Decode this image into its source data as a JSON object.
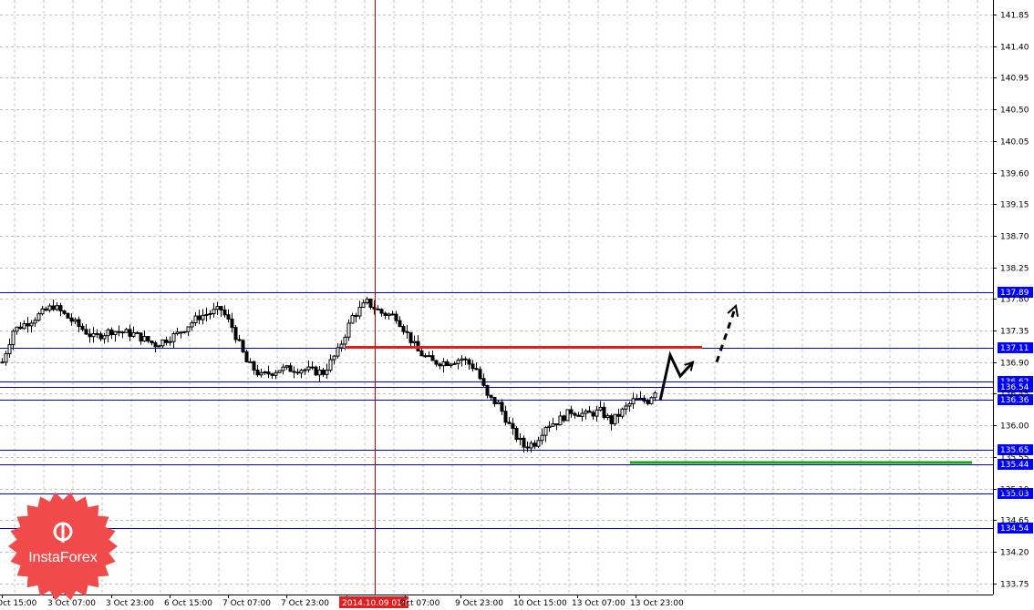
{
  "chart_data": {
    "type": "candlestick",
    "title": "",
    "ylim": [
      133.5,
      142.0
    ],
    "y_ticks": [
      "141.85",
      "141.40",
      "140.95",
      "140.50",
      "140.05",
      "139.60",
      "139.15",
      "138.70",
      "138.25",
      "137.80",
      "137.35",
      "136.90",
      "136.45",
      "136.00",
      "135.55",
      "135.10",
      "134.65",
      "134.20",
      "133.75"
    ],
    "x_ticks": [
      "Oct 15:00",
      "3 Oct 07:00",
      "3 Oct 23:00",
      "6 Oct 15:00",
      "7 Oct 07:00",
      "7 Oct 23:00",
      "2014.10.09 01:00",
      "Oct 07:00",
      "9 Oct 23:00",
      "10 Oct 15:00",
      "13 Oct 07:00",
      "13 Oct 23:00"
    ],
    "highlighted_time": "2014.10.09 01:00",
    "levels": [
      {
        "value": 137.89,
        "label": "137.89"
      },
      {
        "value": 137.11,
        "label": "137.11"
      },
      {
        "value": 136.62,
        "label": "136.62"
      },
      {
        "value": 136.54,
        "label": "136.54"
      },
      {
        "value": 136.36,
        "label": "136.36"
      },
      {
        "value": 135.65,
        "label": "135.65"
      },
      {
        "value": 135.44,
        "label": "135.44"
      },
      {
        "value": 135.03,
        "label": "135.03"
      },
      {
        "value": 134.54,
        "label": "134.54"
      }
    ],
    "resistance_level": 137.11,
    "support_level": 135.47,
    "price_waypoints": [
      [
        0,
        136.9
      ],
      [
        3,
        137.35
      ],
      [
        8,
        137.5
      ],
      [
        14,
        137.7
      ],
      [
        20,
        137.45
      ],
      [
        25,
        137.25
      ],
      [
        30,
        137.35
      ],
      [
        36,
        137.3
      ],
      [
        42,
        137.15
      ],
      [
        48,
        137.3
      ],
      [
        54,
        137.55
      ],
      [
        60,
        137.65
      ],
      [
        63,
        137.4
      ],
      [
        67,
        136.9
      ],
      [
        71,
        136.7
      ],
      [
        76,
        136.8
      ],
      [
        82,
        136.8
      ],
      [
        88,
        136.75
      ],
      [
        92,
        137.05
      ],
      [
        96,
        137.55
      ],
      [
        100,
        137.75
      ],
      [
        104,
        137.6
      ],
      [
        108,
        137.55
      ],
      [
        111,
        137.3
      ],
      [
        114,
        137.05
      ],
      [
        118,
        136.9
      ],
      [
        122,
        136.9
      ],
      [
        126,
        136.95
      ],
      [
        130,
        136.8
      ],
      [
        133,
        136.4
      ],
      [
        136,
        136.3
      ],
      [
        140,
        135.9
      ],
      [
        143,
        135.7
      ],
      [
        146,
        135.75
      ],
      [
        149,
        136.0
      ],
      [
        152,
        136.05
      ],
      [
        156,
        136.2
      ],
      [
        160,
        136.15
      ],
      [
        164,
        136.2
      ],
      [
        167,
        136.05
      ],
      [
        170,
        136.2
      ],
      [
        173,
        136.35
      ],
      [
        177,
        136.35
      ],
      [
        179,
        136.5
      ]
    ],
    "forecast_path": [
      [
        724,
        136.35
      ],
      [
        735,
        137.0
      ],
      [
        746,
        136.7
      ],
      [
        760,
        136.9
      ]
    ],
    "forecast_dashed_arrow": [
      [
        786,
        136.9
      ],
      [
        807,
        137.7
      ]
    ],
    "colors": {
      "candle": "#000000",
      "grid": "#c0c0c0",
      "level_line": "#0000cc",
      "level_label_bg": "#0000ff",
      "resistance": "#e02020",
      "support": "#1aa31a",
      "time_marker": "#c00000",
      "highlight_label_bg": "#e02020",
      "logo": "#f04a4a"
    },
    "logo_text": "InstaForex",
    "grid": true
  }
}
